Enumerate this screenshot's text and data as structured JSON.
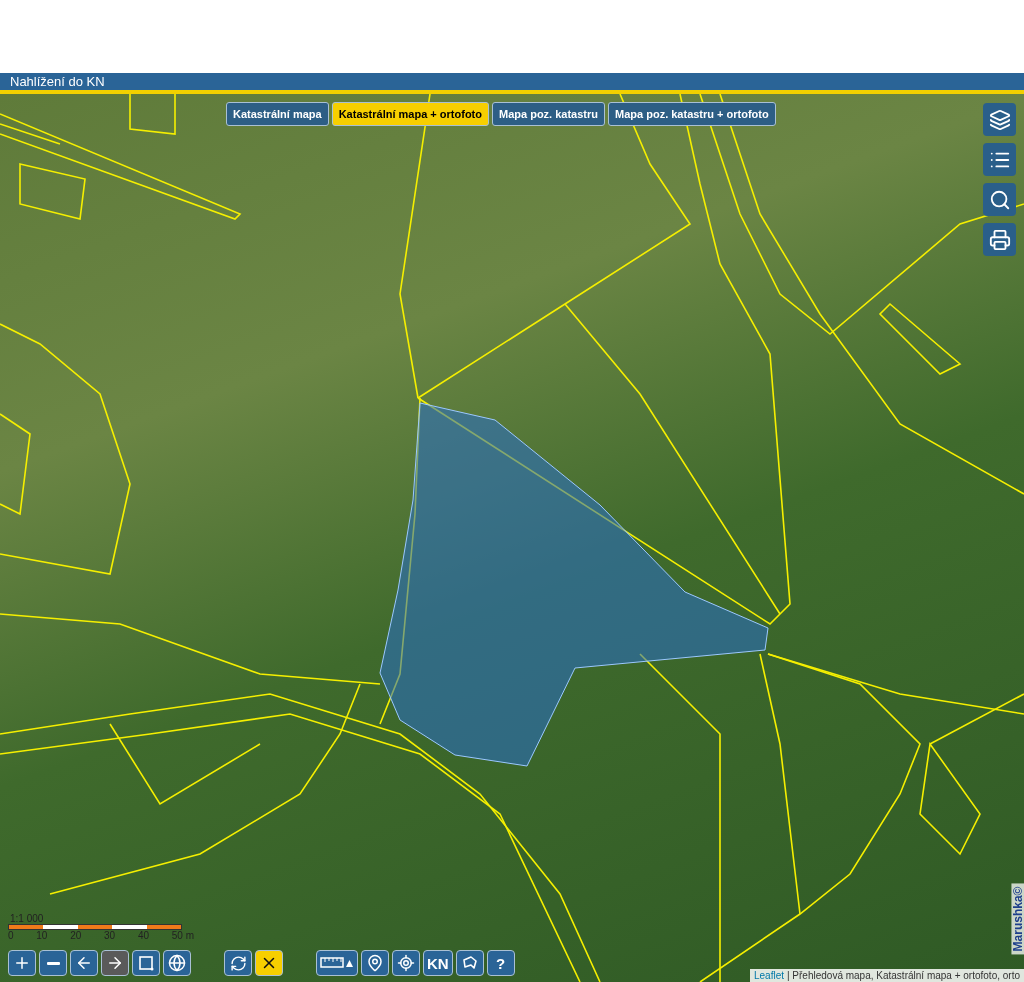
{
  "window": {
    "title": "Nahlížení do KN"
  },
  "map_tabs": [
    {
      "label": "Katastrální mapa",
      "selected": false
    },
    {
      "label": "Katastrální mapa + ortofoto",
      "selected": true
    },
    {
      "label": "Mapa poz. katastru",
      "selected": false
    },
    {
      "label": "Mapa poz. katastru + ortofoto",
      "selected": false
    }
  ],
  "side_tools": [
    {
      "kind": "layers"
    },
    {
      "kind": "legend"
    },
    {
      "kind": "search"
    },
    {
      "kind": "print"
    }
  ],
  "scale": {
    "ratio": "1:1 000",
    "ticks": [
      "0",
      "10",
      "20",
      "30",
      "40",
      "50 m"
    ]
  },
  "toolbar": [
    {
      "kind": "zoom-in",
      "selected": false,
      "disabled": false
    },
    {
      "kind": "zoom-out",
      "selected": false,
      "disabled": false
    },
    {
      "kind": "back",
      "selected": false,
      "disabled": false
    },
    {
      "kind": "forward",
      "selected": false,
      "disabled": true
    },
    {
      "kind": "zoom-box",
      "selected": false,
      "disabled": false
    },
    {
      "kind": "globe",
      "selected": false,
      "disabled": false
    },
    {
      "kind": "refresh",
      "selected": false,
      "disabled": false
    },
    {
      "kind": "clear",
      "selected": true,
      "disabled": false
    },
    {
      "kind": "measure",
      "selected": false,
      "disabled": false
    },
    {
      "kind": "gps",
      "selected": false,
      "disabled": false
    },
    {
      "kind": "locate",
      "selected": false,
      "disabled": false
    },
    {
      "kind": "text",
      "label": "KN",
      "selected": false,
      "disabled": false
    },
    {
      "kind": "polygon",
      "selected": false,
      "disabled": false
    },
    {
      "kind": "text",
      "label": "?",
      "selected": false,
      "disabled": false
    }
  ],
  "attribution": {
    "link": "Leaflet",
    "text": "| Přehledová mapa, Katastrální mapa + ortofoto, orto"
  },
  "watermark": "Marushka©"
}
